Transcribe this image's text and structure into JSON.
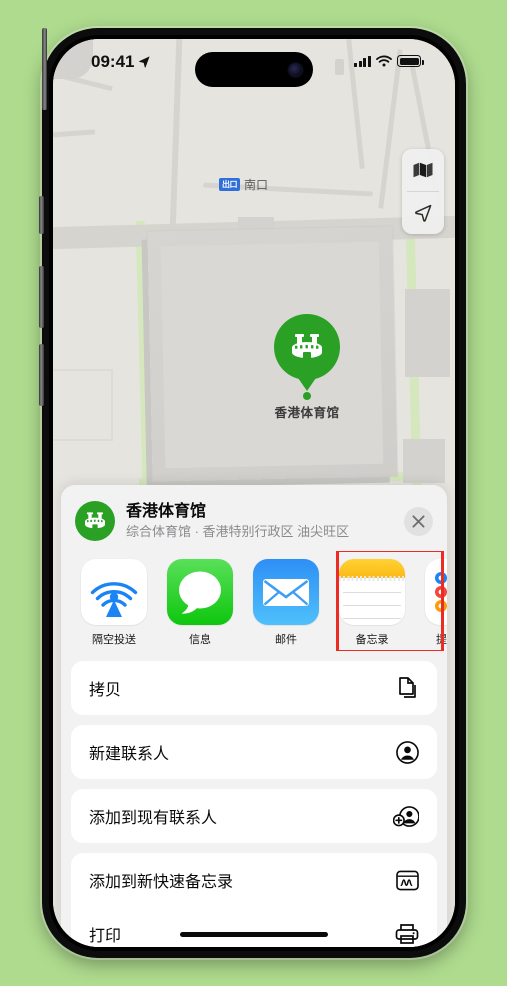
{
  "status_bar": {
    "time": "09:41",
    "location_arrow_icon": "location-arrow-icon",
    "signal_icon": "cellular-signal-icon",
    "wifi_icon": "wifi-icon",
    "battery_icon": "battery-full-icon"
  },
  "map": {
    "pin_label": "香港体育馆",
    "pin_icon": "stadium-icon",
    "exit_badge": "出口",
    "exit_label": "南口",
    "controls": [
      {
        "name": "map-type-button",
        "icon": "folded-map-icon"
      },
      {
        "name": "locate-me-button",
        "icon": "location-arrow-icon"
      }
    ]
  },
  "share_sheet": {
    "title": "香港体育馆",
    "subtitle": "综合体育馆 · 香港特别行政区 油尖旺区",
    "avatar_icon": "stadium-icon",
    "close_icon": "close-icon",
    "apps": [
      {
        "label": "隔空投送",
        "icon": "airdrop-icon",
        "highlighted": false
      },
      {
        "label": "信息",
        "icon": "messages-icon",
        "highlighted": false
      },
      {
        "label": "邮件",
        "icon": "mail-icon",
        "highlighted": false
      },
      {
        "label": "备忘录",
        "icon": "notes-icon",
        "highlighted": true
      },
      {
        "label": "提醒事项",
        "icon": "reminders-icon",
        "highlighted": false
      }
    ],
    "actions": [
      {
        "label": "拷贝",
        "icon": "copy-icon"
      },
      {
        "label": "新建联系人",
        "icon": "new-contact-icon"
      },
      {
        "label": "添加到现有联系人",
        "icon": "add-to-contact-icon"
      },
      {
        "label": "添加到新快速备忘录",
        "icon": "quick-note-icon"
      },
      {
        "label": "打印",
        "icon": "printer-icon"
      }
    ]
  },
  "colors": {
    "background": "#aedb8e",
    "accent_green": "#2aa024",
    "highlight_red": "#ee2b22",
    "messages_green": "#0ec60e",
    "mail_blue": "#2e8ff5",
    "notes_yellow": "#fbb915"
  }
}
